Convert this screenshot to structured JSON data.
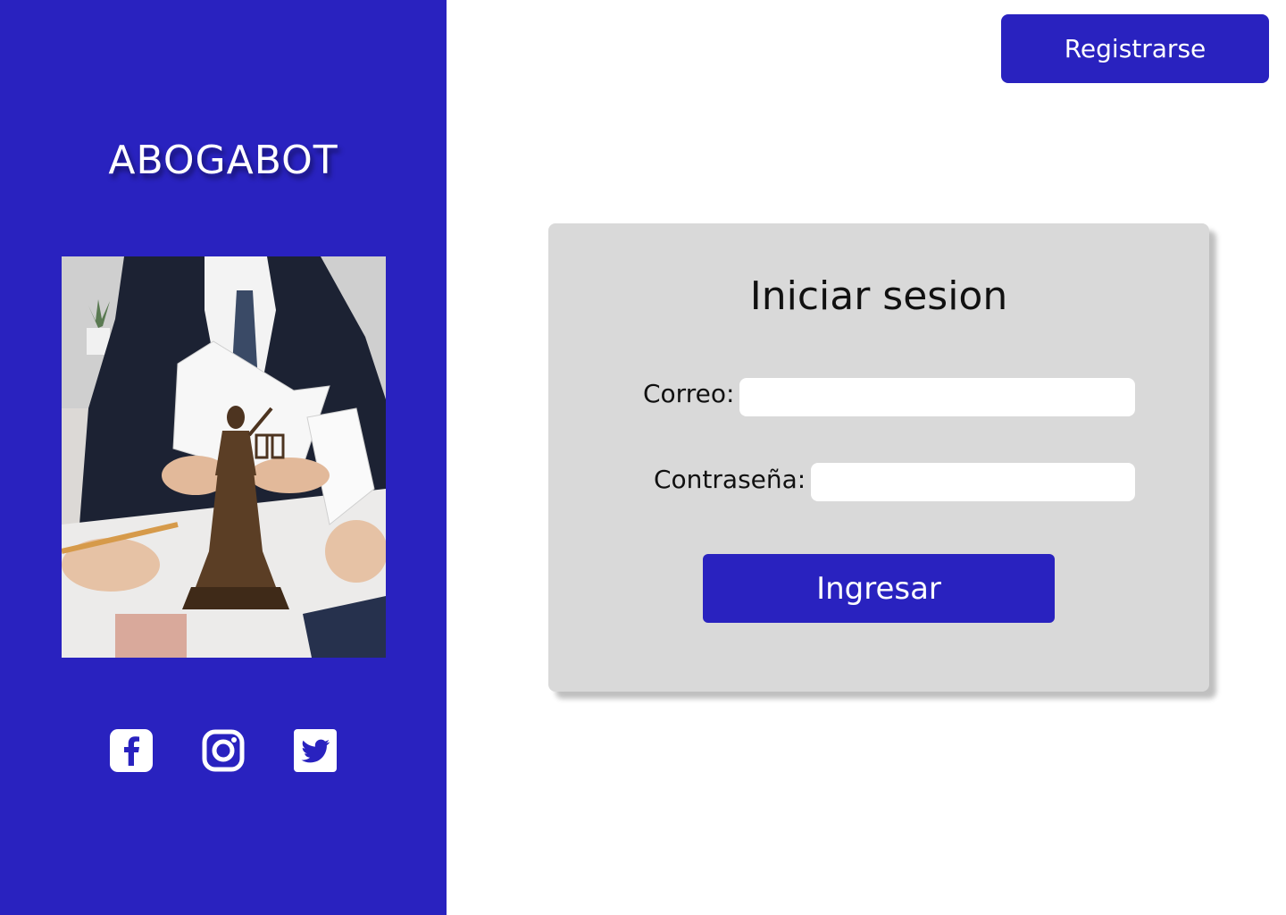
{
  "brand": {
    "name": "ABOGABOT"
  },
  "header": {
    "register_label": "Registrarse"
  },
  "login": {
    "title": "Iniciar sesion",
    "email_label": "Correo:",
    "email_value": "",
    "password_label": "Contraseña:",
    "password_value": "",
    "submit_label": "Ingresar"
  },
  "social": [
    {
      "name": "facebook-icon"
    },
    {
      "name": "instagram-icon"
    },
    {
      "name": "twitter-icon"
    }
  ],
  "hero_image": {
    "alt": "Abogados revisando documentos junto a una estatua de la justicia"
  },
  "colors": {
    "brand": "#2922bf",
    "card": "#d9d9d9",
    "page": "#ffffff"
  }
}
